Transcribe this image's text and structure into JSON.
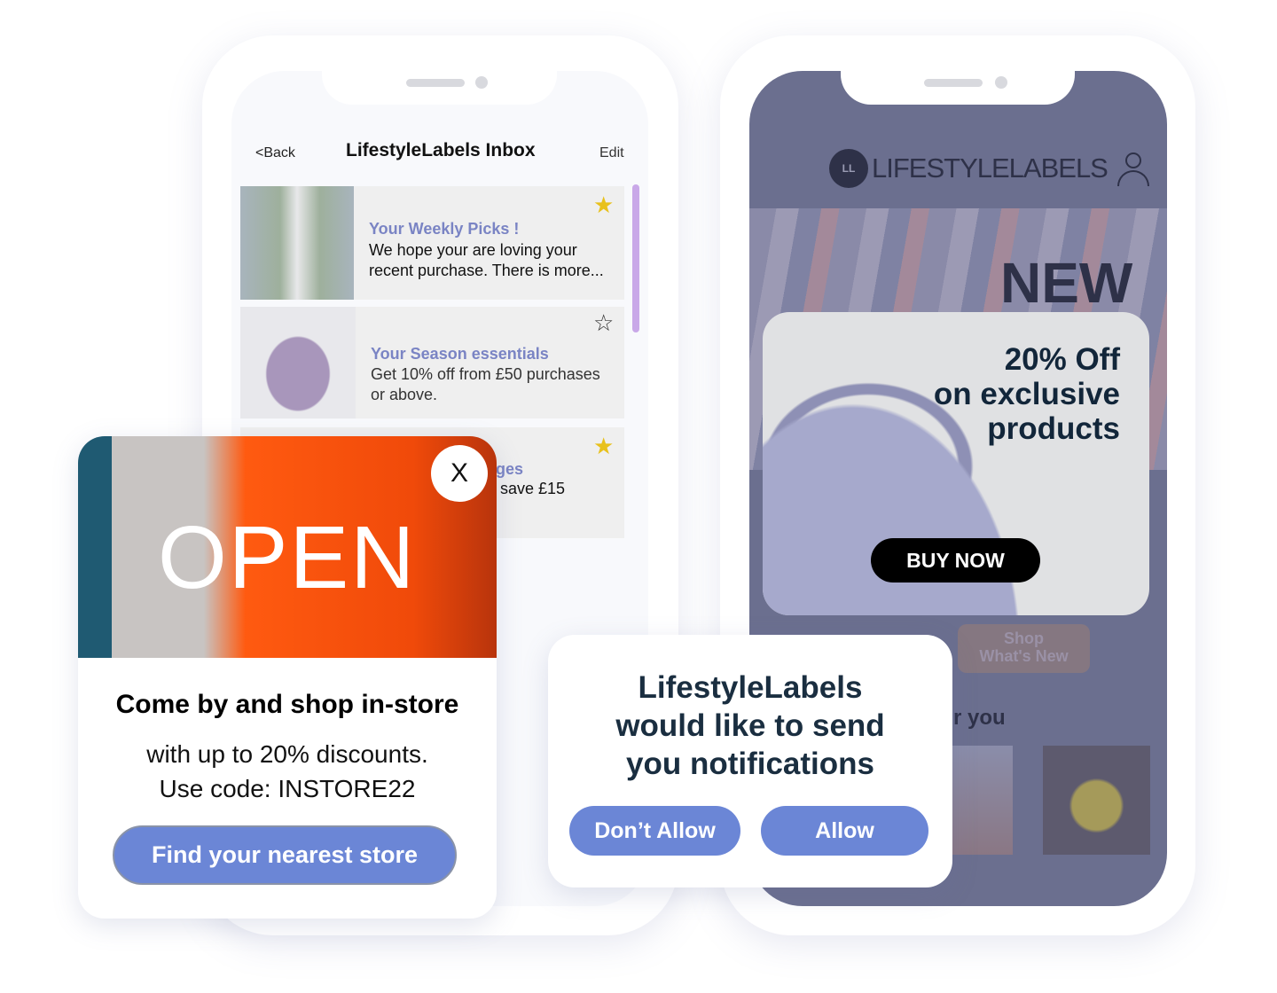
{
  "inbox": {
    "back_label": "<Back",
    "title": "LifestyleLabels Inbox",
    "edit_label": "Edit",
    "messages": [
      {
        "title": "Your Weekly Picks !",
        "body": "We hope your are loving your recent purchase. There is more...",
        "starred": true
      },
      {
        "title": "Your Season essentials",
        "body": "Get 10% off from £50 purchases or above.",
        "starred": false
      },
      {
        "title": "ges",
        "body": "save £15",
        "starred": true
      }
    ]
  },
  "store": {
    "logo": "LIFESTYLELABELS",
    "hero_label": "NEW",
    "offer": {
      "line1": "20% Off",
      "line2": "on exclusive",
      "line3": "products",
      "button": "BUY NOW"
    },
    "shop_button": {
      "line1": "Shop",
      "line2": "What's New"
    },
    "section_partial": "r you"
  },
  "instore_popup": {
    "image_text": "OPEN",
    "close_label": "X",
    "title": "Come by and shop in-store",
    "line1": "with up to 20% discounts.",
    "line2": "Use code: INSTORE22",
    "button": "Find your nearest store"
  },
  "notification_prompt": {
    "line1": "LifestyleLabels",
    "line2": "would like to send",
    "line3": "you notifications",
    "deny": "Don’t Allow",
    "allow": "Allow"
  },
  "colors": {
    "accent": "#6b86d6",
    "title_purple": "#7a84c4",
    "star": "#e8c11c",
    "overlay": "#6b6f8f"
  }
}
